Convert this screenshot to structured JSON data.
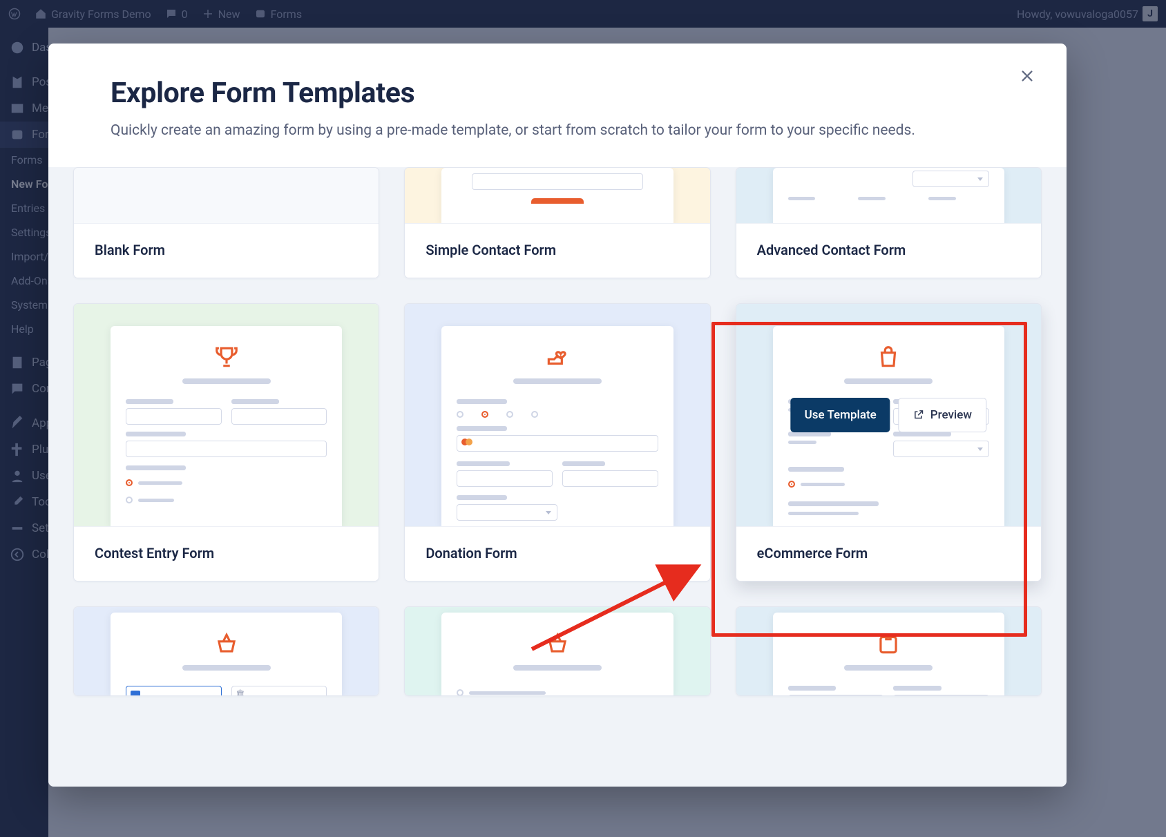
{
  "adminbar": {
    "site_title": "Gravity Forms Demo",
    "comments": "0",
    "new_label": "New",
    "forms_label": "Forms",
    "greeting": "Howdy, vowuvaloga0057",
    "avatar_initial": "J"
  },
  "sidebar": {
    "dashboard": "Dashboard",
    "posts": "Posts",
    "media": "Media",
    "forms": "Forms",
    "submenu": {
      "forms": "Forms",
      "new_form": "New Form",
      "entries": "Entries",
      "settings": "Settings",
      "import_export": "Import/Export",
      "addons": "Add-Ons",
      "system_status": "System Status",
      "help": "Help"
    },
    "pages": "Pages",
    "comments": "Comments",
    "appearance": "Appearance",
    "plugins": "Plugins",
    "users": "Users",
    "tools": "Tools",
    "settings": "Settings",
    "collapse": "Collapse menu"
  },
  "modal": {
    "title": "Explore Form Templates",
    "subtitle": "Quickly create an amazing form by using a pre-made template, or start from scratch to tailor your form to your specific needs.",
    "close_label": "Close",
    "use_template": "Use Template",
    "preview": "Preview"
  },
  "templates": {
    "blank": "Blank Form",
    "simple_contact": "Simple Contact Form",
    "advanced_contact": "Advanced Contact Form",
    "contest_entry": "Contest Entry Form",
    "donation": "Donation Form",
    "ecommerce": "eCommerce Form"
  }
}
